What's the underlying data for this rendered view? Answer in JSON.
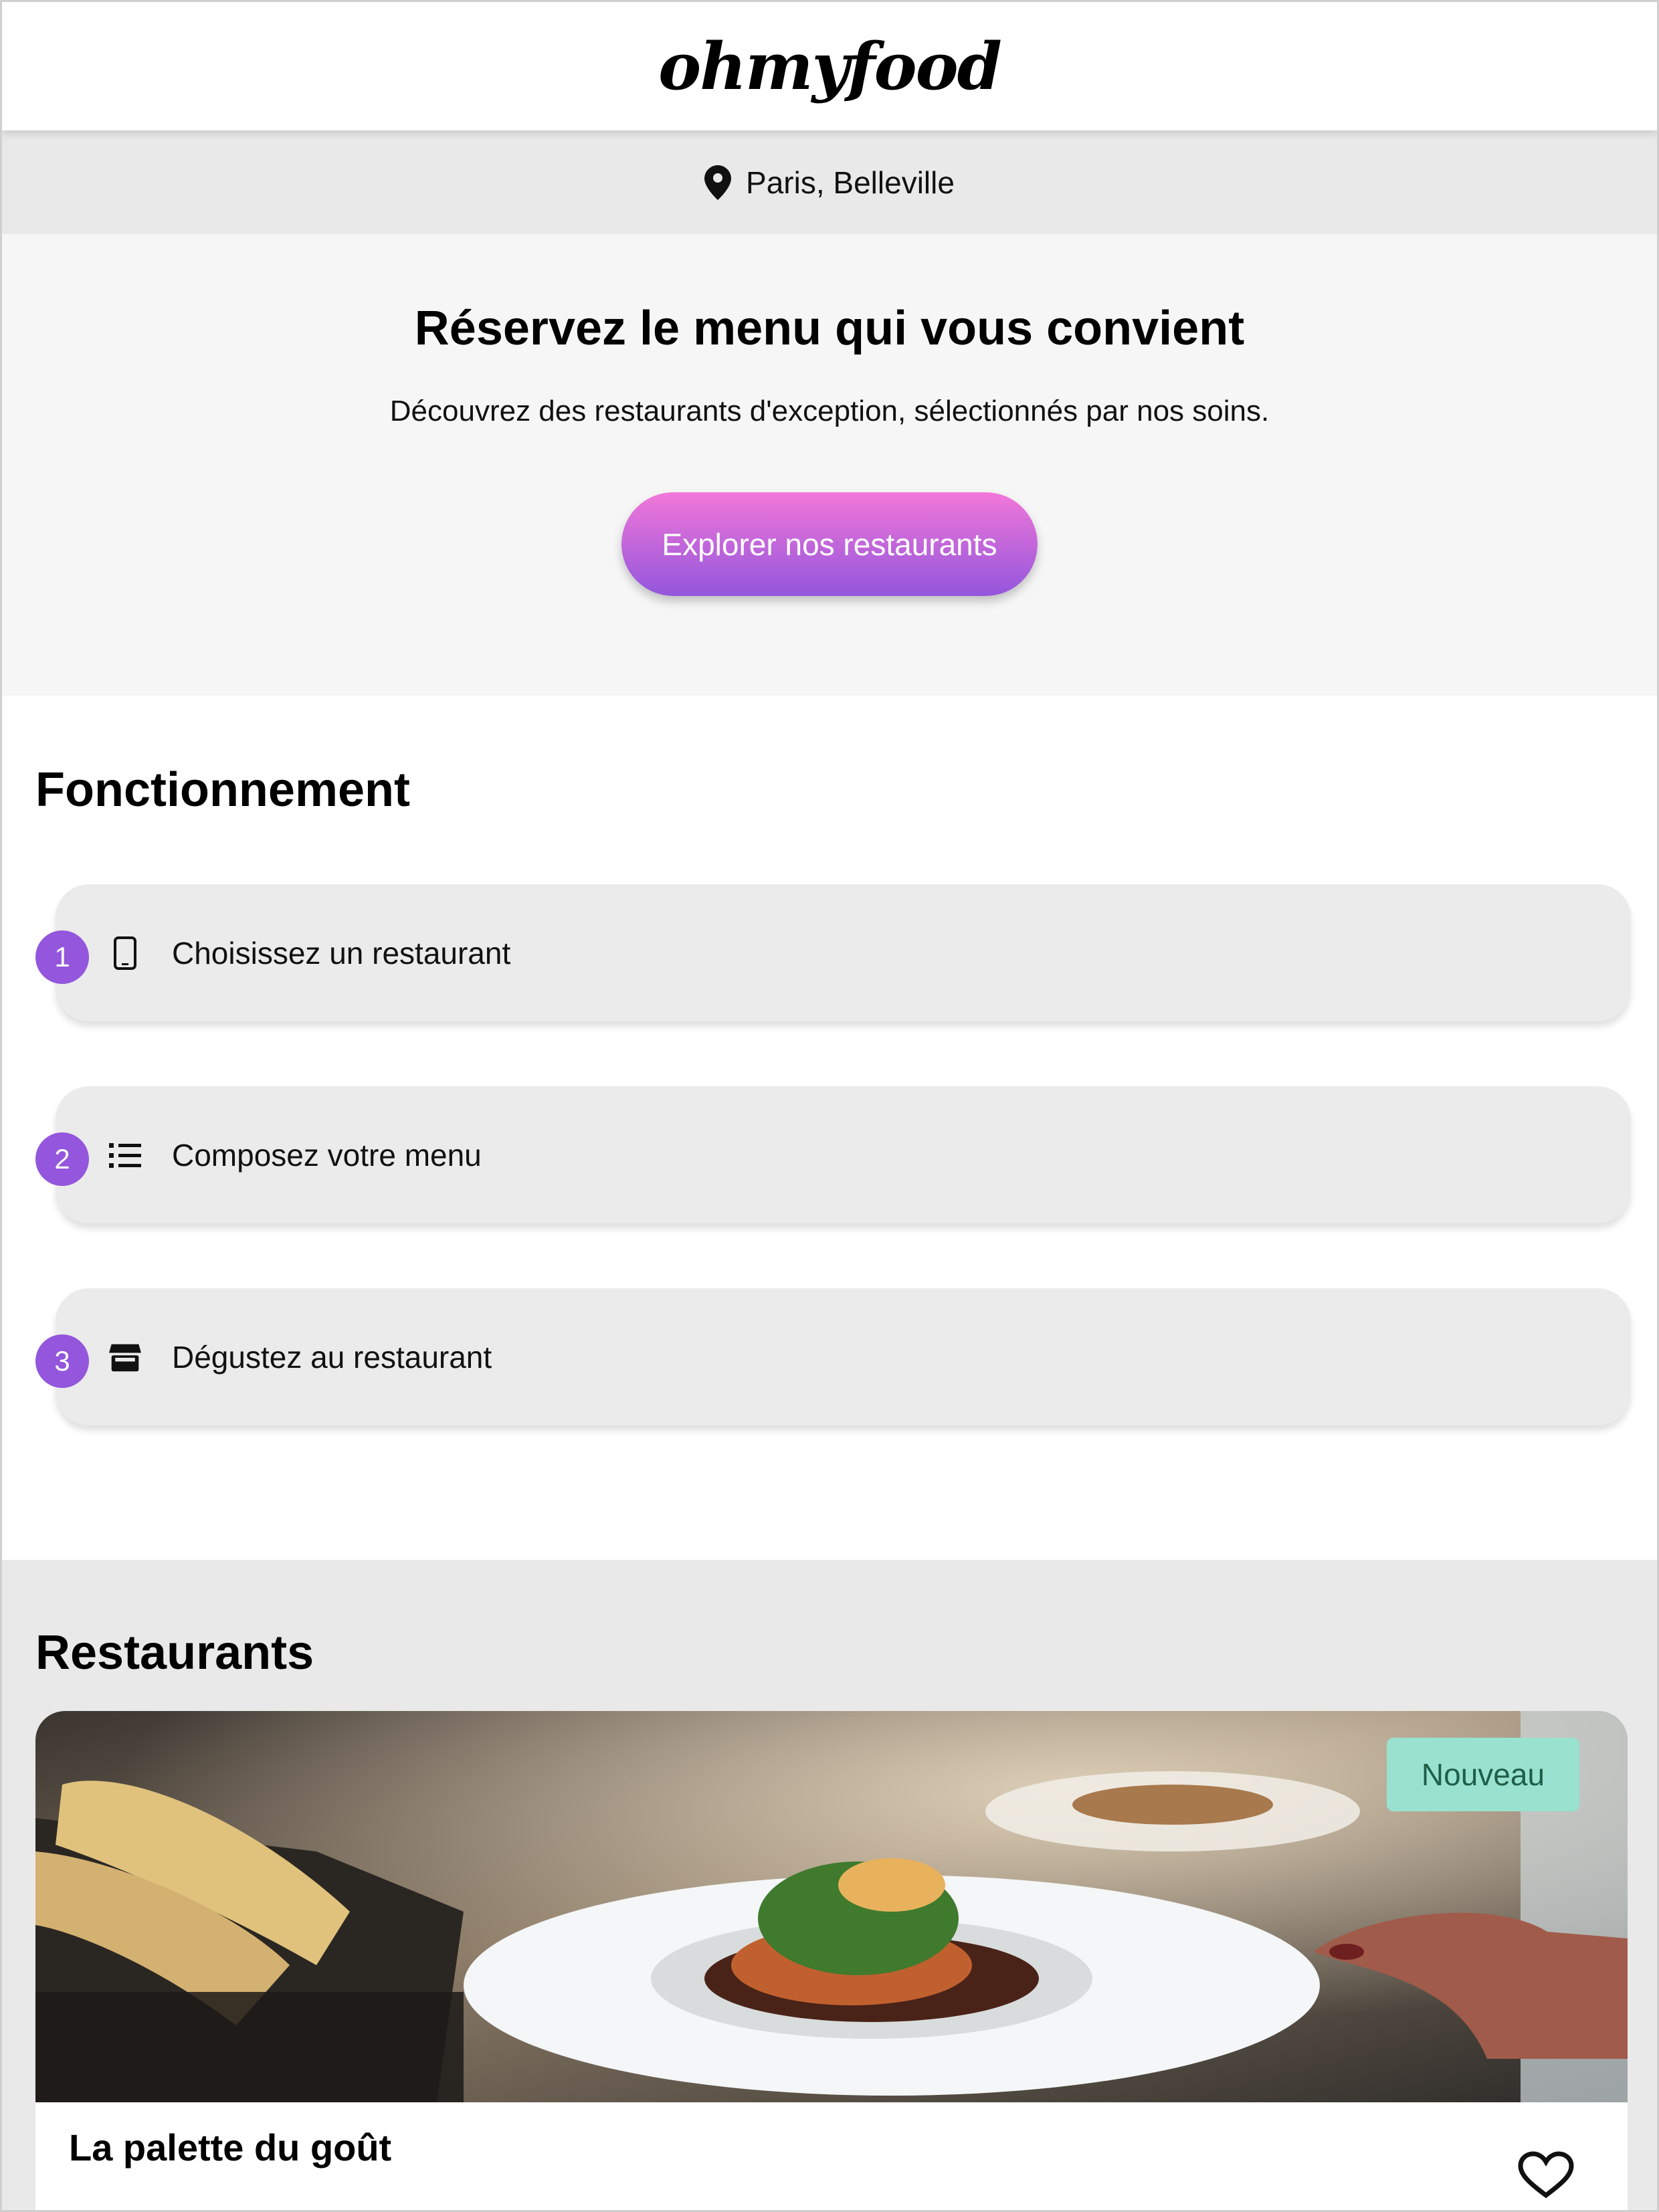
{
  "header": {
    "logo": "ohmyfood"
  },
  "location": {
    "icon": "map-pin-icon",
    "label": "Paris, Belleville"
  },
  "hero": {
    "title": "Réservez le menu qui vous convient",
    "subtitle": "Découvrez des restaurants d'exception, sélectionnés par nos soins.",
    "cta_label": "Explorer nos restaurants"
  },
  "how": {
    "title": "Fonctionnement",
    "steps": [
      {
        "number": "1",
        "icon": "smartphone-icon",
        "label": "Choisissez un restaurant"
      },
      {
        "number": "2",
        "icon": "list-icon",
        "label": "Composez votre menu"
      },
      {
        "number": "3",
        "icon": "store-icon",
        "label": "Dégustez au restaurant"
      }
    ]
  },
  "restaurants": {
    "title": "Restaurants",
    "cards": [
      {
        "name": "La palette du goût",
        "badge": "Nouveau",
        "favorite_icon": "heart-icon"
      }
    ]
  },
  "colors": {
    "accent_purple": "#9356dc",
    "accent_pink": "#f277d9",
    "badge_bg": "#99e2d0",
    "badge_text": "#1f5e47"
  }
}
